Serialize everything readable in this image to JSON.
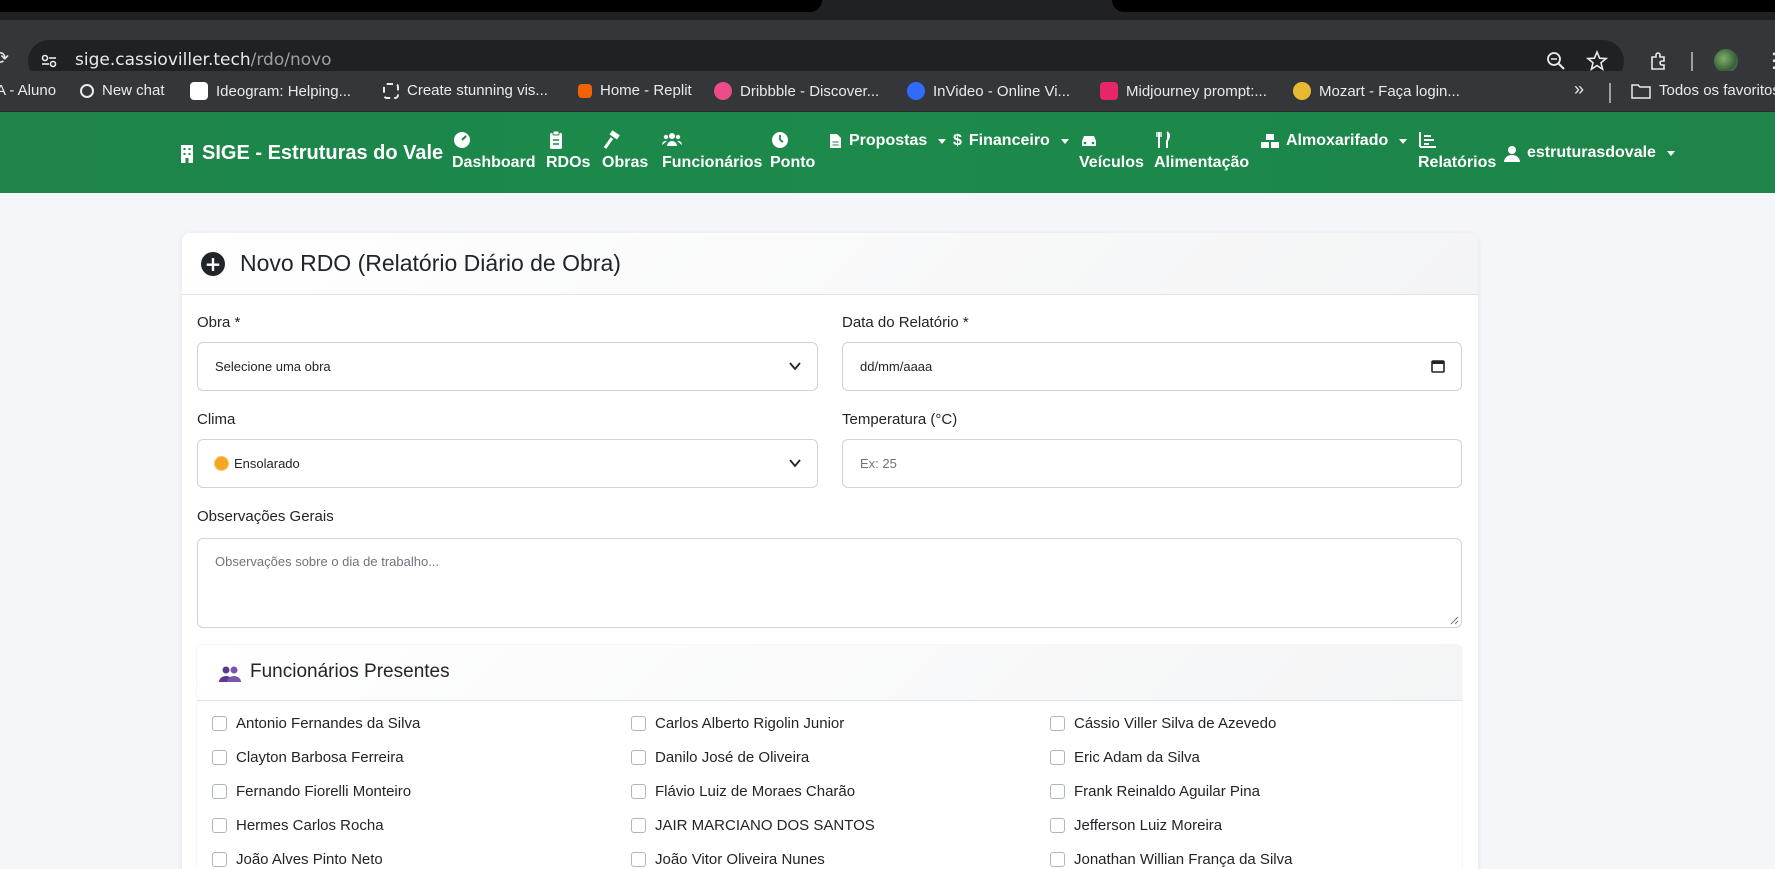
{
  "browser": {
    "url_host": "sige.cassioviller.tech",
    "url_path": "/rdo/novo",
    "bookmarks": [
      {
        "label": "A - Aluno",
        "color": ""
      },
      {
        "label": "New chat",
        "color": "#000000"
      },
      {
        "label": "Ideogram: Helping...",
        "color": "#ffffff"
      },
      {
        "label": "Create stunning vis...",
        "color": "#35363a"
      },
      {
        "label": "Home - Replit",
        "color": "#f26207"
      },
      {
        "label": "Dribbble - Discover...",
        "color": "#ea4c89"
      },
      {
        "label": "InVideo - Online Vi...",
        "color": "#2f6bff"
      },
      {
        "label": "Midjourney prompt:...",
        "color": "#e8246b"
      },
      {
        "label": "Mozart - Faça login...",
        "color": "#e8b931"
      }
    ],
    "more_bookmarks": "»",
    "bookmarks_folder": "Todos os favoritos"
  },
  "navbar": {
    "brand": "SIGE - Estruturas do Vale",
    "items": [
      {
        "label": "Dashboard",
        "icon": "gauge-icon"
      },
      {
        "label": "RDOs",
        "icon": "clipboard-icon"
      },
      {
        "label": "Obras",
        "icon": "hammer-icon"
      },
      {
        "label": "Funcionários",
        "icon": "users-icon"
      },
      {
        "label": "Ponto",
        "icon": "clock-icon"
      },
      {
        "label": "Propostas",
        "icon": "file-icon"
      },
      {
        "label": "Financeiro",
        "icon": "dollar-icon"
      },
      {
        "label": "Veículos",
        "icon": "car-icon"
      },
      {
        "label": "Alimentação",
        "icon": "utensils-icon"
      },
      {
        "label": "Almoxarifado",
        "icon": "warehouse-icon"
      },
      {
        "label": "Relatórios",
        "icon": "chart-icon"
      }
    ],
    "user": "estruturasdovale",
    "dollar_sign": "$"
  },
  "form": {
    "title": "Novo RDO (Relatório Diário de Obra)",
    "obra_label": "Obra *",
    "obra_value": "Selecione uma obra",
    "data_label": "Data do Relatório *",
    "data_placeholder": "dd/mm/aaaa",
    "clima_label": "Clima",
    "clima_value": "Ensolarado",
    "temp_label": "Temperatura (°C)",
    "temp_placeholder": "Ex: 25",
    "obs_label": "Observações Gerais",
    "obs_placeholder": "Observações sobre o dia de trabalho..."
  },
  "employees": {
    "title": "Funcionários Presentes",
    "list": [
      "Antonio Fernandes da Silva",
      "Carlos Alberto Rigolin Junior",
      "Cássio Viller Silva de Azevedo",
      "Clayton Barbosa Ferreira",
      "Danilo José de Oliveira",
      "Eric Adam da Silva",
      "Fernando Fiorelli Monteiro",
      "Flávio Luiz de Moraes Charão",
      "Frank Reinaldo Aguilar Pina",
      "Hermes Carlos Rocha",
      "JAIR MARCIANO DOS SANTOS",
      "Jefferson Luiz Moreira",
      "João Alves Pinto Neto",
      "João Vitor Oliveira Nunes",
      "Jonathan Willian França da Silva"
    ]
  },
  "colors": {
    "navbar": "#1e8449",
    "page_bg": "#f4f6f9",
    "chrome_dark": "#35363a"
  }
}
